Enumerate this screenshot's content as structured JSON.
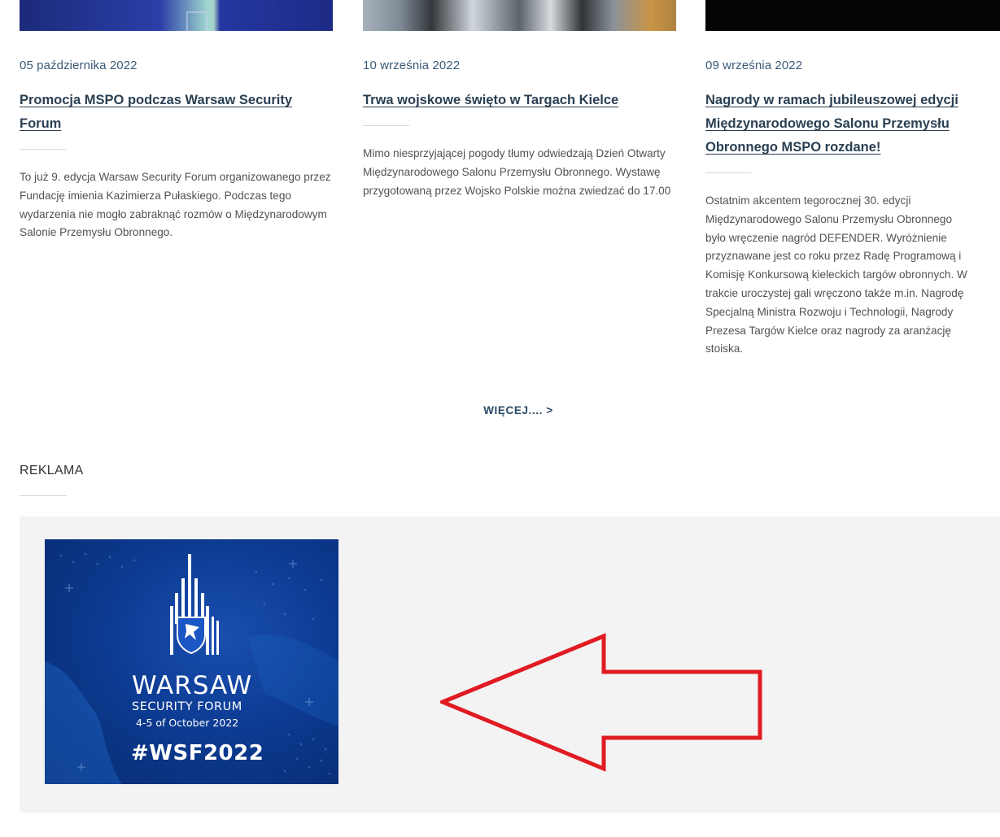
{
  "news": [
    {
      "date": "05 października 2022",
      "title": "Promocja MSPO podczas Warsaw Security Forum",
      "excerpt": "To już 9. edycja Warsaw Security Forum organizowanego przez Fundację imienia Kazimierza Pułaskiego. Podczas tego wydarzenia nie mogło zabraknąć rozmów o Międzynarodowym Salonie Przemysłu Obronnego."
    },
    {
      "date": "10 września 2022",
      "title": "Trwa wojskowe święto w Targach Kielce",
      "excerpt": "Mimo niesprzyjającej pogody tłumy odwiedzają Dzień Otwarty Międzynarodowego Salonu Przemysłu Obronnego. Wystawę przygotowaną przez Wojsko Polskie można zwiedzać do 17.00"
    },
    {
      "date": "09 września 2022",
      "title": "Nagrody w ramach jubileuszowej edycji Międzynarodowego Salonu Przemysłu Obronnego MSPO rozdane!",
      "excerpt_lines": [
        "Ostatnim akcentem tegorocznej 30. edycji",
        "Międzynarodowego Salonu Przemysłu Obronnego",
        "było wręczenie nagród DEFENDER. Wyróżnienie",
        "przyznawane jest co roku przez Radę Programową i",
        "Komisję Konkursową kieleckich targów obronnych. W",
        "trakcie uroczystej gali wręczono także m.in. Nagrodę",
        "Specjalną Ministra Rozwoju i Technologii, Nagrody",
        "Prezesa Targów Kielce oraz nagrody za aranżację",
        "stoiska."
      ]
    }
  ],
  "more_label": "WIĘCEJ.... >",
  "ad_section": {
    "heading": "REKLAMA",
    "banner": {
      "line1": "WARSAW",
      "line2": "SECURITY FORUM",
      "line3": "4-5 of October 2022",
      "hashtag": "#WSF2022"
    },
    "arrow_color": "#e01b22"
  }
}
